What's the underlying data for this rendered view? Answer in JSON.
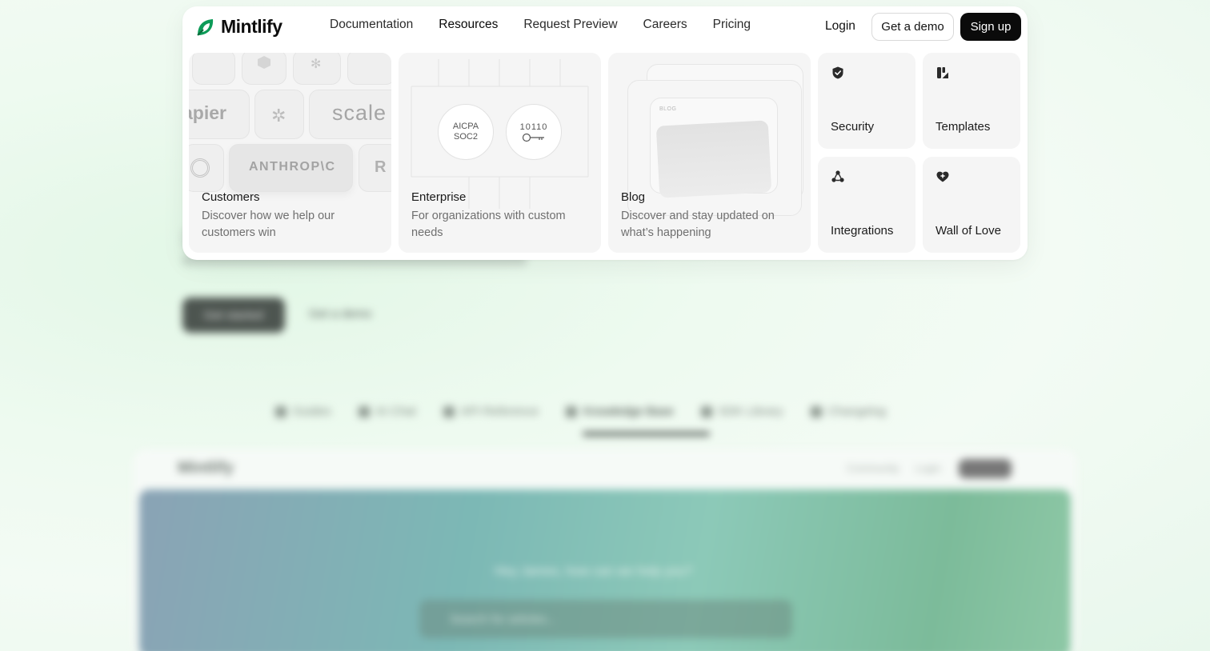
{
  "brand": {
    "name": "Mintlify",
    "logo_icon": "mintlify-leaf-icon",
    "accent": "#0d9b58"
  },
  "nav": {
    "items": [
      {
        "label": "Documentation",
        "active": false
      },
      {
        "label": "Resources",
        "active": true
      },
      {
        "label": "Request Preview",
        "active": false
      },
      {
        "label": "Careers",
        "active": false
      },
      {
        "label": "Pricing",
        "active": false
      }
    ],
    "login": "Login",
    "demo": "Get a demo",
    "signup": "Sign up"
  },
  "resources": {
    "customers": {
      "title": "Customers",
      "description": "Discover how we help our customers win",
      "logos": [
        "apier",
        "scale",
        "ANTHROP\\C",
        "R"
      ]
    },
    "enterprise": {
      "title": "Enterprise",
      "description": "For organizations with custom needs",
      "badge_line1": "AICPA",
      "badge_line2": "SOC2",
      "key_badge_text": "10110"
    },
    "blog": {
      "title": "Blog",
      "description": "Discover and stay updated on what’s happening",
      "art_label": "BLOG"
    },
    "quick_links": [
      {
        "label": "Security",
        "icon": "shield-check-icon"
      },
      {
        "label": "Templates",
        "icon": "templates-icon"
      },
      {
        "label": "Integrations",
        "icon": "integrations-icon"
      },
      {
        "label": "Wall of Love",
        "icon": "heart-badge-icon"
      }
    ]
  },
  "background": {
    "cta_primary": "Get started",
    "cta_secondary": "Get a demo",
    "tabs": [
      "Guides",
      "AI Chat",
      "API Reference",
      "Knowledge Base",
      "SDK Library",
      "Changelog"
    ],
    "active_tab": "Knowledge Base",
    "preview_logo": "Mintlify",
    "preview_links": [
      "Community",
      "Login"
    ],
    "preview_question": "Hey James, how can we help you?",
    "preview_search_placeholder": "Search for articles..."
  }
}
